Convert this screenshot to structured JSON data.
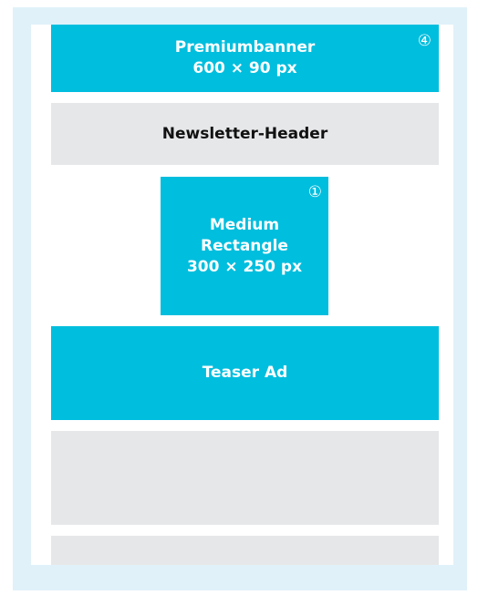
{
  "colors": {
    "frame_background": "#e0f1f9",
    "ad_slot": "#00bede",
    "content_slot": "#e6e7e9",
    "ad_text": "#ffffff",
    "content_text": "#111111"
  },
  "slots": {
    "premiumbanner": {
      "title": "Premiumbanner",
      "size": "600 × 90 px",
      "badge": "④"
    },
    "newsletter_header": {
      "title": "Newsletter-Header"
    },
    "medium_rectangle": {
      "title_line1": "Medium",
      "title_line2": "Rectangle",
      "size": "300 × 250 px",
      "badge": "①"
    },
    "teaser_ad": {
      "title": "Teaser Ad"
    }
  }
}
